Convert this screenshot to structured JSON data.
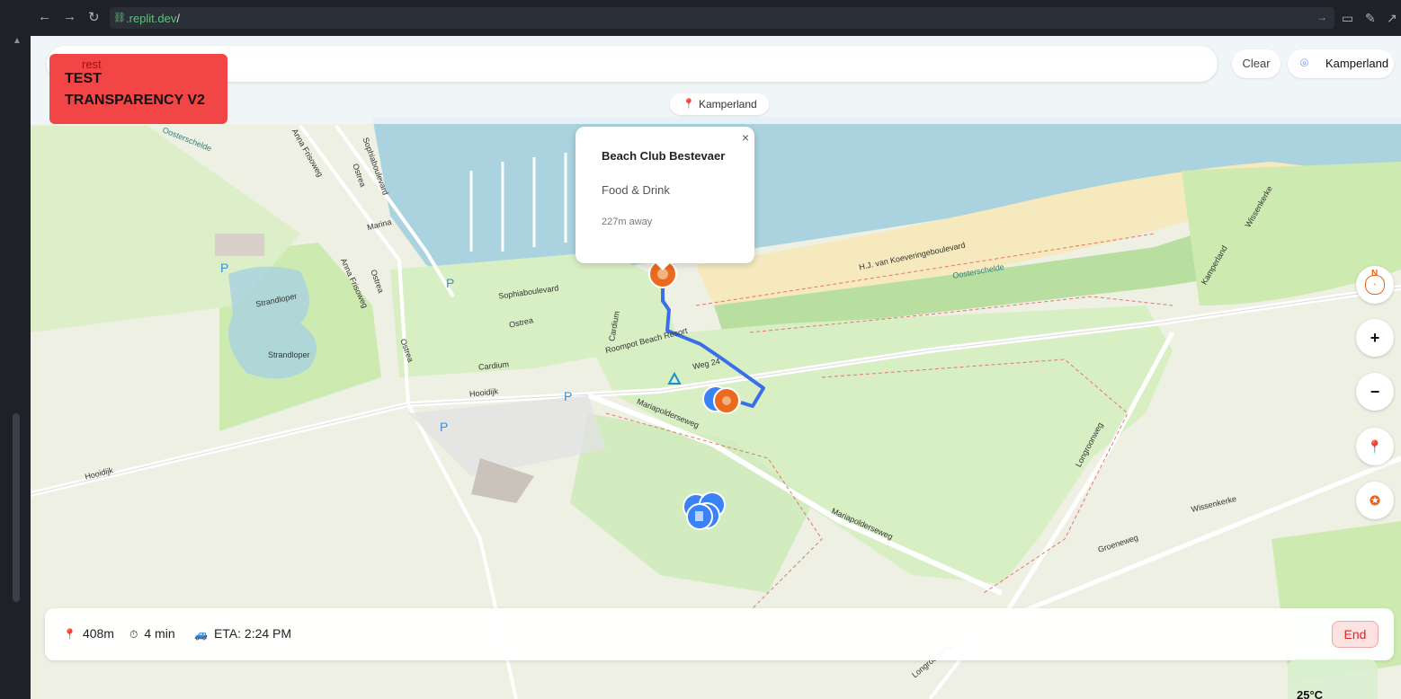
{
  "browser": {
    "url_prefix": ".replit.dev",
    "url_suffix": "/"
  },
  "header": {
    "clear_label": "Clear",
    "location_label": "Kamperland",
    "location_chip": "Kamperland"
  },
  "test_badge": {
    "underlying_text": "rest",
    "label": "TEST TRANSPARENCY V2"
  },
  "popup": {
    "title": "Beach Club Bestevaer",
    "category": "Food & Drink",
    "distance": "227m away",
    "close_symbol": "×"
  },
  "map_controls": {
    "compass_label": "N",
    "zoom_in": "+",
    "zoom_out": "−"
  },
  "map_labels": {
    "oosterschelde_1": "Oosterschelde",
    "oosterschelde_2": "Oosterschelde",
    "strandloper_1": "Strandloper",
    "strandloper_2": "Strandloper",
    "anna_friso_1": "Anna Frisoweg",
    "anna_friso_2": "Anna Frisoweg",
    "sophiaboulevard_1": "Sophiaboulevard",
    "sophiaboulevard_2": "Sophiaboulevard",
    "marina": "Marina",
    "ostrea_1": "Ostrea",
    "ostrea_2": "Ostrea",
    "ostrea_3": "Ostrea",
    "ostrea_4": "Ostrea",
    "cardium_1": "Cardium",
    "cardium_2": "Cardium",
    "hooidijk_1": "Hooidijk",
    "hooidijk_2": "Hooidijk",
    "roompot": "Roompot Beach Resort",
    "weg24": "Weg 24",
    "mariapolderseweg_1": "Mariapolderseweg",
    "mariapolderseweg_2": "Mariapolderseweg",
    "longroonweg_1": "Longroonweg",
    "longroonweg_2": "Longroonweg",
    "groeneweg": "Groeneweg",
    "wissenkerke_1": "Wissenkerke",
    "wissenkerke_2": "Wissenkerke",
    "kamperland": "Kamperland",
    "koeveringe": "H.J. van Koeveringeboulevard"
  },
  "navigation": {
    "distance": "408m",
    "duration": "4 min",
    "eta": "ETA: 2:24 PM",
    "end_label": "End"
  },
  "weather": {
    "temperature": "25°C"
  },
  "colors": {
    "water": "#aad3df",
    "sand": "#f5e9bd",
    "grass": "#cdebb0",
    "route": "#3b6ee8",
    "poi_food": "#ea6a1f",
    "poi_hotel": "#3b82f6",
    "end_button": "#dc2626",
    "test_badge": "#f24545"
  }
}
